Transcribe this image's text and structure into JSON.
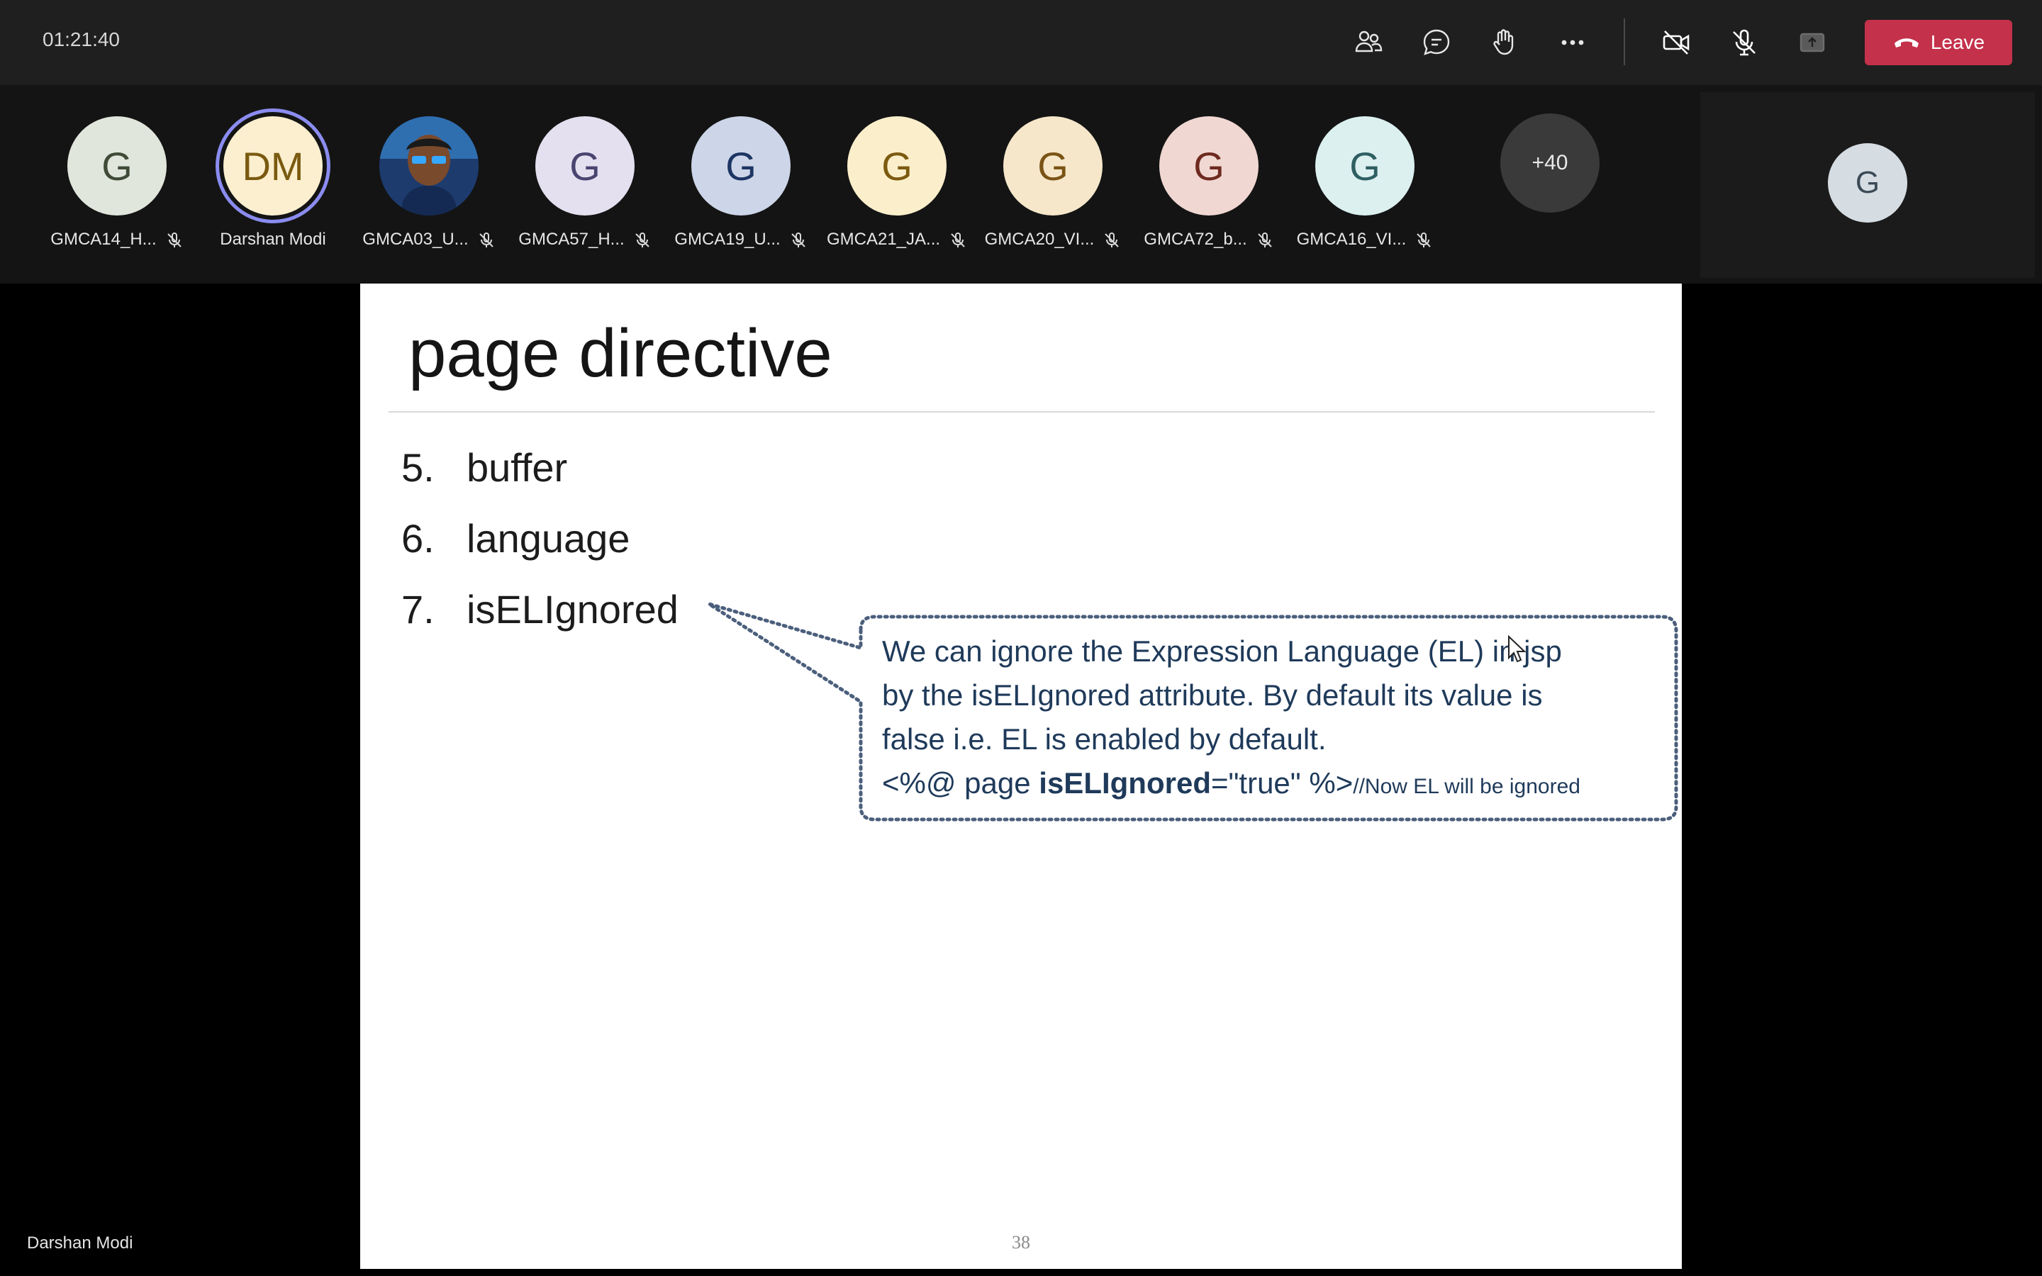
{
  "meeting": {
    "timer": "01:21:40",
    "leave_label": "Leave"
  },
  "toolbar": {
    "icons": [
      "people-icon",
      "chat-icon",
      "raise-hand-icon",
      "more-options-icon",
      "camera-off-icon",
      "mic-off-icon",
      "share-tray-icon"
    ]
  },
  "participants": [
    {
      "initials": "G",
      "name": "GMCA14_H...",
      "bg": "#e1e6dc",
      "fg": "#3f4a37",
      "muted": true
    },
    {
      "initials": "DM",
      "name": "Darshan Modi",
      "bg": "#fbefcf",
      "fg": "#7a5a10",
      "muted": false,
      "speaking": true
    },
    {
      "initials": "",
      "name": "GMCA03_U...",
      "bg": "#1e3b6e",
      "fg": "#ffffff",
      "muted": true,
      "photo": true
    },
    {
      "initials": "G",
      "name": "GMCA57_H...",
      "bg": "#e4e0f0",
      "fg": "#4a4470",
      "muted": true
    },
    {
      "initials": "G",
      "name": "GMCA19_U...",
      "bg": "#cdd6e8",
      "fg": "#1d3563",
      "muted": true
    },
    {
      "initials": "G",
      "name": "GMCA21_JA...",
      "bg": "#fbefcb",
      "fg": "#7c5a10",
      "muted": true
    },
    {
      "initials": "G",
      "name": "GMCA20_VI...",
      "bg": "#f6e7cb",
      "fg": "#7a5415",
      "muted": true
    },
    {
      "initials": "G",
      "name": "GMCA72_b...",
      "bg": "#f0d7d2",
      "fg": "#6e2a1f",
      "muted": true
    },
    {
      "initials": "G",
      "name": "GMCA16_VI...",
      "bg": "#dcf0f0",
      "fg": "#2f5f62",
      "muted": true
    }
  ],
  "more_participants": "+40",
  "self_view": {
    "initials": "G"
  },
  "stage": {
    "presenter_name": "Darshan Modi"
  },
  "slide": {
    "title": "page directive",
    "bullets": [
      {
        "num": "5.",
        "text": "buffer"
      },
      {
        "num": "6.",
        "text": "language"
      },
      {
        "num": "7.",
        "text": "isELIgnored"
      }
    ],
    "callout_lines": [
      "We can ignore the Expression Language (EL) in jsp",
      "by the isELIgnored attribute. By default its value is",
      "false i.e. EL is enabled by default."
    ],
    "code_prefix": "<%@ page ",
    "code_bold": "isELIgnored",
    "code_suffix": "=\"true\" %>",
    "code_comment": "//Now EL will be ignored",
    "page_number": "38"
  },
  "colors": {
    "leave": "#c4314b",
    "speaking_ring": "#8b8cf0",
    "callout_text": "#1f3a5a"
  }
}
